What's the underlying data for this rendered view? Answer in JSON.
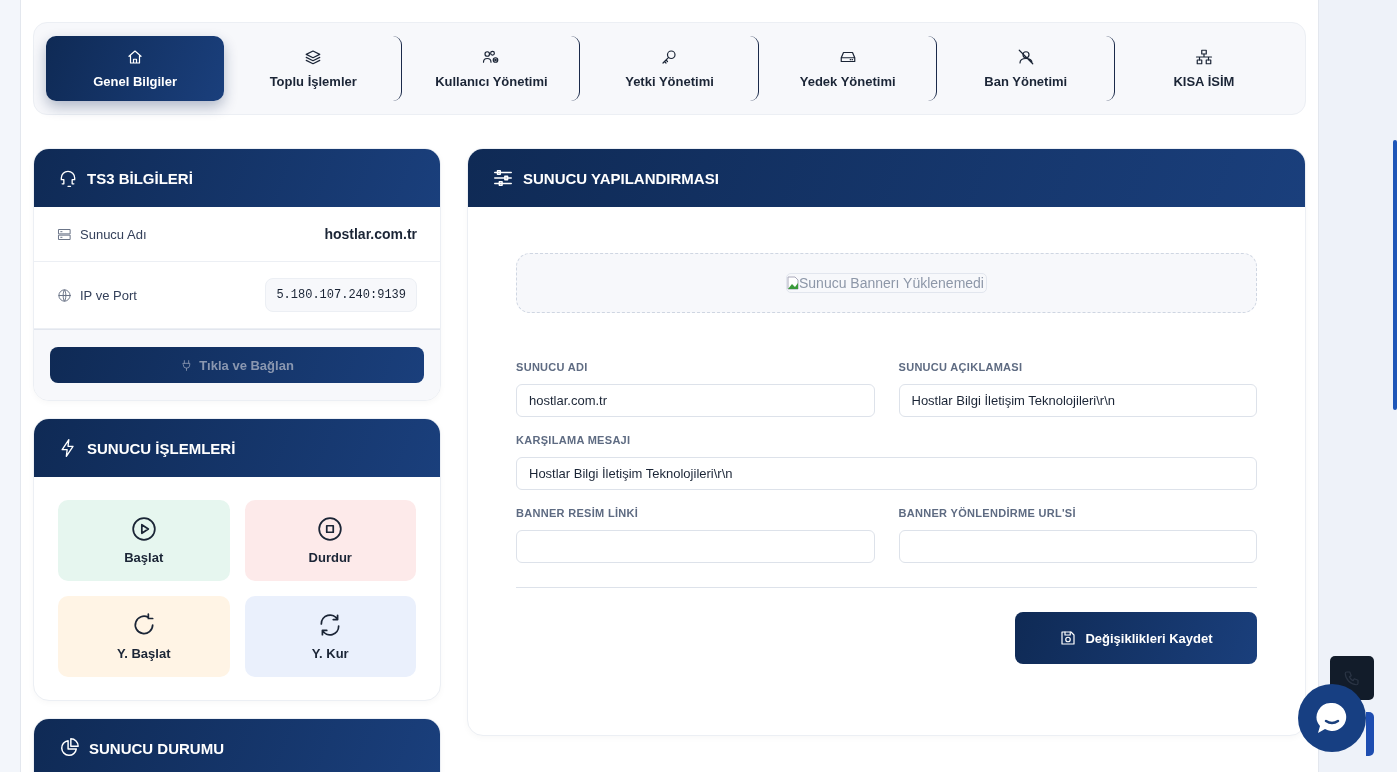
{
  "tabs": [
    {
      "label": "Genel Bilgiler",
      "selected": true
    },
    {
      "label": "Toplu İşlemler",
      "selected": false
    },
    {
      "label": "Kullanıcı Yönetimi",
      "selected": false
    },
    {
      "label": "Yetki Yönetimi",
      "selected": false
    },
    {
      "label": "Yedek Yönetimi",
      "selected": false
    },
    {
      "label": "Ban Yönetimi",
      "selected": false
    },
    {
      "label": "KISA İSİM",
      "selected": false
    }
  ],
  "ts3_info": {
    "title": "TS3 BİLGİLERİ",
    "rows": [
      {
        "kind": "text",
        "label": "Sunucu Adı",
        "value": "hostlar.com.tr"
      },
      {
        "kind": "code",
        "label": "IP ve Port",
        "value": "5.180.107.240:9139"
      }
    ],
    "connect_button": {
      "label": "Tıkla ve Bağlan",
      "disabled": true
    }
  },
  "server_actions": {
    "title": "SUNUCU İŞLEMLERİ",
    "actions": [
      {
        "label": "Başlat",
        "color": "#e6f6ef"
      },
      {
        "label": "Durdur",
        "color": "#fdeaea"
      },
      {
        "label": "Y. Başlat",
        "color": "#fff4e5"
      },
      {
        "label": "Y. Kur",
        "color": "#eaf0fc"
      }
    ]
  },
  "server_status": {
    "title": "SUNUCU DURUMU"
  },
  "server_config": {
    "title": "SUNUCU YAPILANDIRMASI",
    "banner_alt": "Sunucu Bannerı Yüklenemedi",
    "fields": [
      {
        "label": "SUNUCU ADI",
        "value": "hostlar.com.tr",
        "wide": false
      },
      {
        "label": "SUNUCU AÇIKLAMASI",
        "value": "Hostlar Bilgi İletişim Teknolojileri\\r\\n",
        "wide": false
      },
      {
        "label": "KARŞILAMA MESAJI",
        "value": "Hostlar Bilgi İletişim Teknolojileri\\r\\n",
        "wide": true
      },
      {
        "label": "BANNER RESİM LİNKİ",
        "wide": false
      },
      {
        "label": "BANNER YÖNLENDİRME URL'Sİ",
        "wide": false
      }
    ],
    "save_button": "Değişiklikleri Kaydet"
  }
}
